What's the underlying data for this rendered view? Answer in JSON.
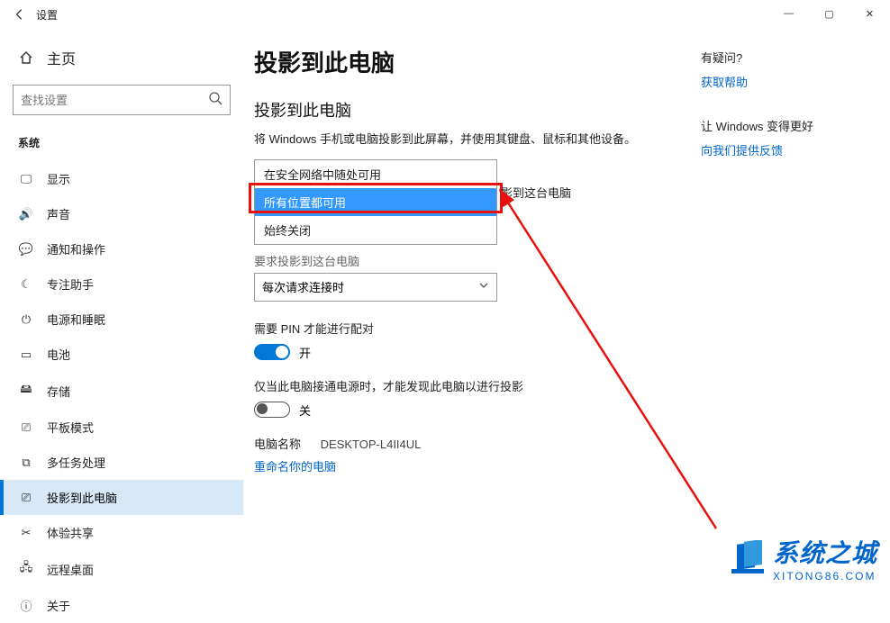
{
  "window": {
    "title": "设置",
    "home": "主页",
    "search_placeholder": "查找设置"
  },
  "winbtns": {
    "min": "—",
    "max": "▢",
    "close": "✕"
  },
  "sidebar": {
    "section": "系统",
    "items": [
      {
        "icon": "🖵",
        "label": "显示"
      },
      {
        "icon": "🔊",
        "label": "声音"
      },
      {
        "icon": "💬",
        "label": "通知和操作"
      },
      {
        "icon": "☾",
        "label": "专注助手"
      },
      {
        "icon": "⏻",
        "label": "电源和睡眠"
      },
      {
        "icon": "▭",
        "label": "电池"
      },
      {
        "icon": "🖴",
        "label": "存储"
      },
      {
        "icon": "⎚",
        "label": "平板模式"
      },
      {
        "icon": "⧉",
        "label": "多任务处理"
      },
      {
        "icon": "⎚",
        "label": "投影到此电脑"
      },
      {
        "icon": "✂",
        "label": "体验共享"
      },
      {
        "icon": "🖧",
        "label": "远程桌面"
      },
      {
        "icon": "ⓘ",
        "label": "关于"
      }
    ],
    "active_index": 9
  },
  "main": {
    "h1": "投影到此电脑",
    "h2": "投影到此电脑",
    "description": "将 Windows 手机或电脑投影到此屏幕，并使用其键盘、鼠标和其他设备。",
    "dropdown_open": {
      "options": [
        "在安全网络中随处可用",
        "所有位置都可用",
        "始终关闭"
      ],
      "hover_index": 1
    },
    "trailing_text": "影到这台电脑",
    "cutoff_label": "要求投影到这台电脑",
    "closed_select": "每次请求连接时",
    "pin_label": "需要 PIN 才能进行配对",
    "pin_state": "开",
    "power_label": "仅当此电脑接通电源时，才能发现此电脑以进行投影",
    "power_state": "关",
    "pcname_label": "电脑名称",
    "pcname_value": "DESKTOP-L4II4UL",
    "rename_link": "重命名你的电脑"
  },
  "right": {
    "q_title": "有疑问?",
    "help_link": "获取帮助",
    "better_title": "让 Windows 变得更好",
    "feedback_link": "向我们提供反馈"
  },
  "watermark": {
    "line1": "系统之城",
    "line2": "XITONG86.COM"
  }
}
